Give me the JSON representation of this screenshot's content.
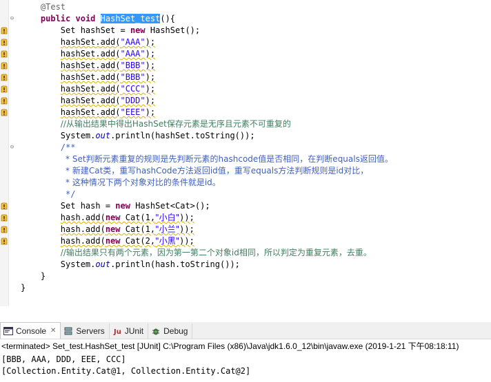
{
  "editor": {
    "lines": [
      {
        "indent": "    ",
        "segments": [
          {
            "t": "@Test",
            "c": "ann"
          }
        ]
      },
      {
        "indent": "    ",
        "segments": [
          {
            "t": "public",
            "c": "kw"
          },
          {
            "t": " "
          },
          {
            "t": "void",
            "c": "kw"
          },
          {
            "t": " "
          },
          {
            "t": "HashSet_test",
            "c": "sel"
          },
          {
            "t": "(){"
          }
        ]
      },
      {
        "indent": "        ",
        "segments": [
          {
            "t": "Set hashSet = "
          },
          {
            "t": "new",
            "c": "kw"
          },
          {
            "t": " HashSet();"
          }
        ]
      },
      {
        "indent": "        ",
        "segments": [
          {
            "t": "hashSet.add(",
            "c": "warn"
          },
          {
            "t": "\"AAA\"",
            "c": "str warn"
          },
          {
            "t": ");",
            "c": "warn"
          }
        ]
      },
      {
        "indent": "        ",
        "segments": [
          {
            "t": "hashSet.add(",
            "c": "warn"
          },
          {
            "t": "\"AAA\"",
            "c": "str warn"
          },
          {
            "t": ");",
            "c": "warn"
          }
        ]
      },
      {
        "indent": "        ",
        "segments": [
          {
            "t": "hashSet.add(",
            "c": "warn"
          },
          {
            "t": "\"BBB\"",
            "c": "str warn"
          },
          {
            "t": ");",
            "c": "warn"
          }
        ]
      },
      {
        "indent": "        ",
        "segments": [
          {
            "t": "hashSet.add(",
            "c": "warn"
          },
          {
            "t": "\"BBB\"",
            "c": "str warn"
          },
          {
            "t": ");",
            "c": "warn"
          }
        ]
      },
      {
        "indent": "        ",
        "segments": [
          {
            "t": "hashSet.add(",
            "c": "warn"
          },
          {
            "t": "\"CCC\"",
            "c": "str warn"
          },
          {
            "t": ");",
            "c": "warn"
          }
        ]
      },
      {
        "indent": "        ",
        "segments": [
          {
            "t": "hashSet.add(",
            "c": "warn"
          },
          {
            "t": "\"DDD\"",
            "c": "str warn"
          },
          {
            "t": ");",
            "c": "warn"
          }
        ]
      },
      {
        "indent": "        ",
        "segments": [
          {
            "t": "hashSet.add(",
            "c": "warn"
          },
          {
            "t": "\"EEE\"",
            "c": "str warn"
          },
          {
            "t": ");",
            "c": "warn"
          }
        ]
      },
      {
        "indent": "        ",
        "segments": [
          {
            "t": "//从输出结果中得出HashSet保存元素是无序且元素不可重复的",
            "c": "cmt"
          }
        ]
      },
      {
        "indent": "        ",
        "segments": [
          {
            "t": "System."
          },
          {
            "t": "out",
            "c": "fld"
          },
          {
            "t": ".println(hashSet.toString());"
          }
        ]
      },
      {
        "indent": "        ",
        "segments": [
          {
            "t": "/**",
            "c": "jd"
          }
        ]
      },
      {
        "indent": "         ",
        "segments": [
          {
            "t": "* Set判断元素重复的规则是先判断元素的hashcode值是否相同，在判断equals返回值。",
            "c": "jd"
          }
        ]
      },
      {
        "indent": "         ",
        "segments": [
          {
            "t": "* 新建Cat类，重写hashCode方法返回id值，重写equals方法判断规则是id对比，",
            "c": "jd"
          }
        ]
      },
      {
        "indent": "         ",
        "segments": [
          {
            "t": "* 这种情况下两个对象对比的条件就是id。",
            "c": "jd"
          }
        ]
      },
      {
        "indent": "         ",
        "segments": [
          {
            "t": "*/",
            "c": "jd"
          }
        ]
      },
      {
        "indent": "        ",
        "segments": [
          {
            "t": "Set hash = "
          },
          {
            "t": "new",
            "c": "kw"
          },
          {
            "t": " HashSet<Cat>();"
          }
        ]
      },
      {
        "indent": "        ",
        "segments": [
          {
            "t": "hash.add(",
            "c": "warn"
          },
          {
            "t": "new",
            "c": "kw warn"
          },
          {
            "t": " Cat(1,",
            "c": "warn"
          },
          {
            "t": "\"小白\"",
            "c": "str warn"
          },
          {
            "t": "));",
            "c": "warn"
          }
        ]
      },
      {
        "indent": "        ",
        "segments": [
          {
            "t": "hash.add(",
            "c": "warn"
          },
          {
            "t": "new",
            "c": "kw warn"
          },
          {
            "t": " Cat(1,",
            "c": "warn"
          },
          {
            "t": "\"小兰\"",
            "c": "str warn"
          },
          {
            "t": "));",
            "c": "warn"
          }
        ]
      },
      {
        "indent": "        ",
        "segments": [
          {
            "t": "hash.add(",
            "c": "warn"
          },
          {
            "t": "new",
            "c": "kw warn"
          },
          {
            "t": " Cat(2,",
            "c": "warn"
          },
          {
            "t": "\"小黑\"",
            "c": "str warn"
          },
          {
            "t": "));",
            "c": "warn"
          }
        ]
      },
      {
        "indent": "        ",
        "segments": [
          {
            "t": "//输出结果只有两个元素，因为第一第二个对象id相同，所以判定为重复元素，去重。",
            "c": "cmt"
          }
        ]
      },
      {
        "indent": "        ",
        "segments": [
          {
            "t": "System."
          },
          {
            "t": "out",
            "c": "fld"
          },
          {
            "t": ".println(hash.toString());"
          }
        ]
      },
      {
        "indent": "    ",
        "segments": [
          {
            "t": "}"
          }
        ]
      },
      {
        "indent": "",
        "segments": [
          {
            "t": "}"
          }
        ]
      }
    ],
    "warning_line_indices": [
      2,
      3,
      4,
      5,
      6,
      7,
      8,
      9,
      17,
      18,
      19,
      20
    ]
  },
  "console": {
    "tabs": [
      {
        "label": "Console",
        "icon": "console-icon",
        "active": true,
        "closable": true
      },
      {
        "label": "Servers",
        "icon": "servers-icon",
        "active": false
      },
      {
        "label": "JUnit",
        "icon": "junit-icon",
        "active": false
      },
      {
        "label": "Debug",
        "icon": "debug-icon",
        "active": false
      }
    ],
    "status": "<terminated> Set_test.HashSet_test [JUnit] C:\\Program Files (x86)\\Java\\jdk1.6.0_12\\bin\\javaw.exe (2019-1-21 下午08:18:11)",
    "output": [
      "[BBB, AAA, DDD, EEE, CCC]",
      "[Collection.Entity.Cat@1, Collection.Entity.Cat@2]"
    ]
  },
  "colors": {
    "keyword": "#7f0055",
    "string": "#2a00ff",
    "comment": "#3f7f5f",
    "javadoc": "#3f5fbf",
    "annotation": "#646464",
    "selection": "#3399ff"
  }
}
